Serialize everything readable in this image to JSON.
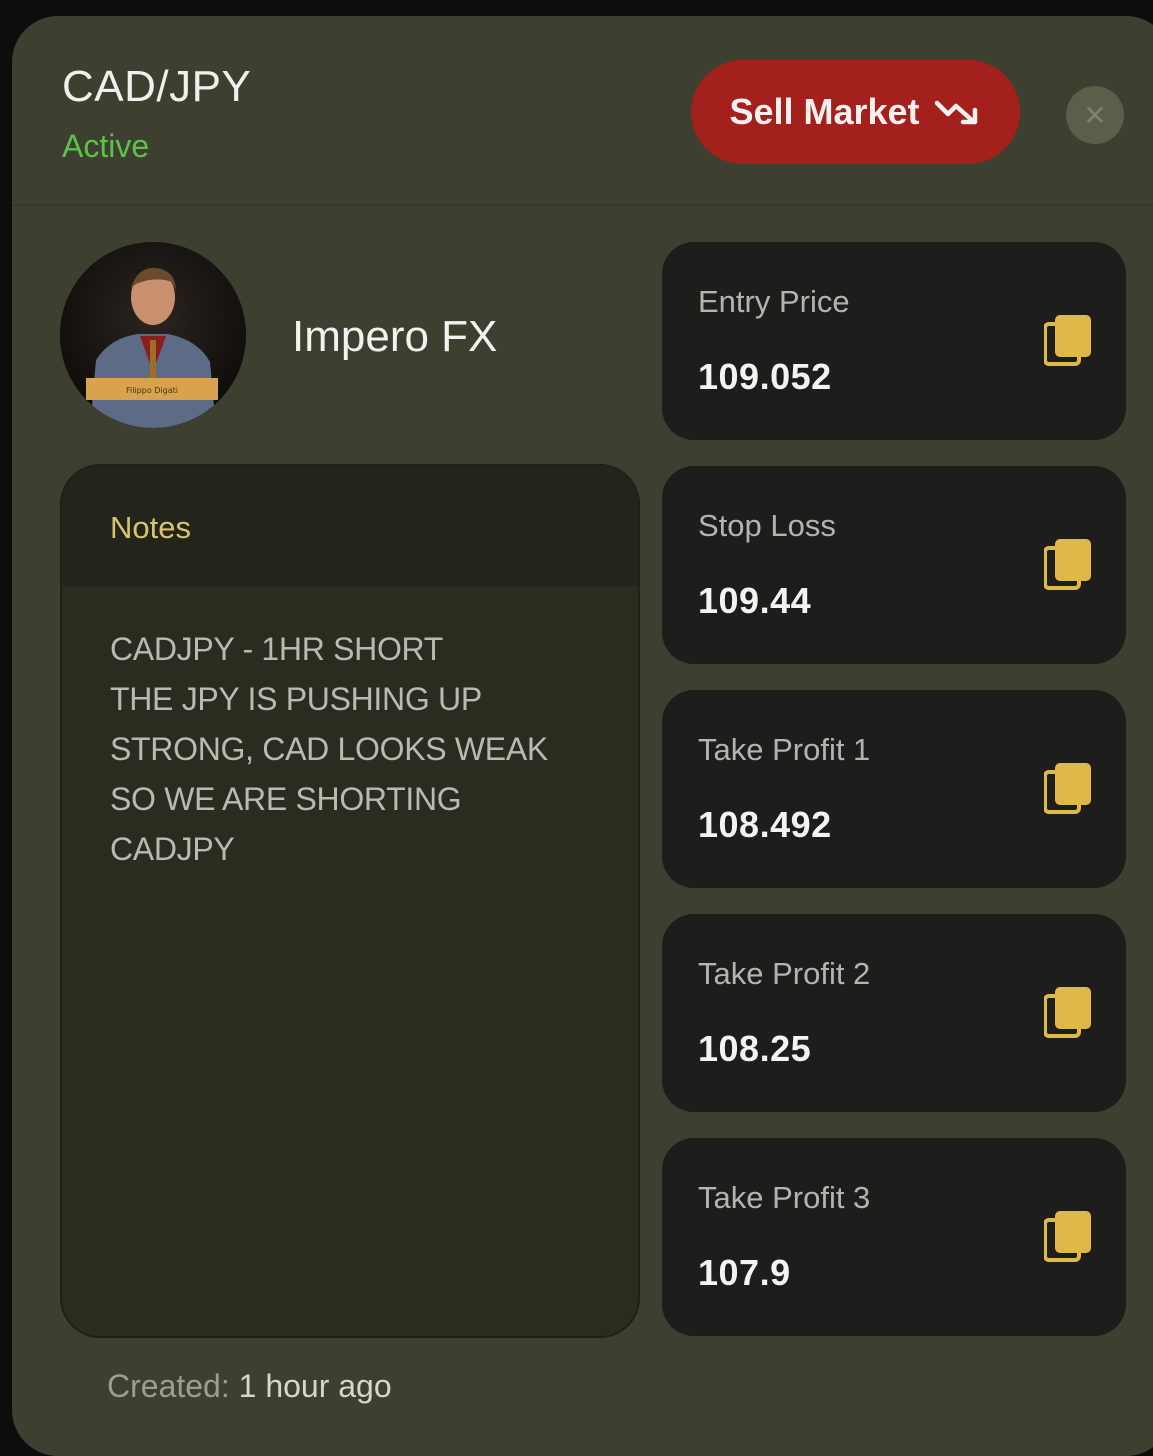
{
  "header": {
    "pair": "CAD/JPY",
    "status": "Active",
    "action_label": "Sell Market",
    "action_icon": "trending-down-icon",
    "close_icon": "close-icon"
  },
  "trader": {
    "name": "Impero FX",
    "avatar_caption": "Filippo Digati"
  },
  "notes": {
    "title": "Notes",
    "body": "CADJPY - 1HR SHORT\nTHE JPY IS PUSHING UP\nSTRONG, CAD LOOKS WEAK\nSO WE ARE SHORTING\nCADJPY"
  },
  "prices": [
    {
      "label": "Entry Price",
      "value": "109.052"
    },
    {
      "label": "Stop Loss",
      "value": "109.44"
    },
    {
      "label": "Take Profit 1",
      "value": "108.492"
    },
    {
      "label": "Take Profit 2",
      "value": "108.25"
    },
    {
      "label": "Take Profit 3",
      "value": "107.9"
    }
  ],
  "footer": {
    "created_label": "Created:",
    "created_value": "1 hour ago"
  },
  "colors": {
    "card": "#3d4030",
    "sell": "#a3201c",
    "active": "#5cc24a",
    "notes_title": "#d8c46c",
    "copy_icon": "#e0b84a"
  }
}
